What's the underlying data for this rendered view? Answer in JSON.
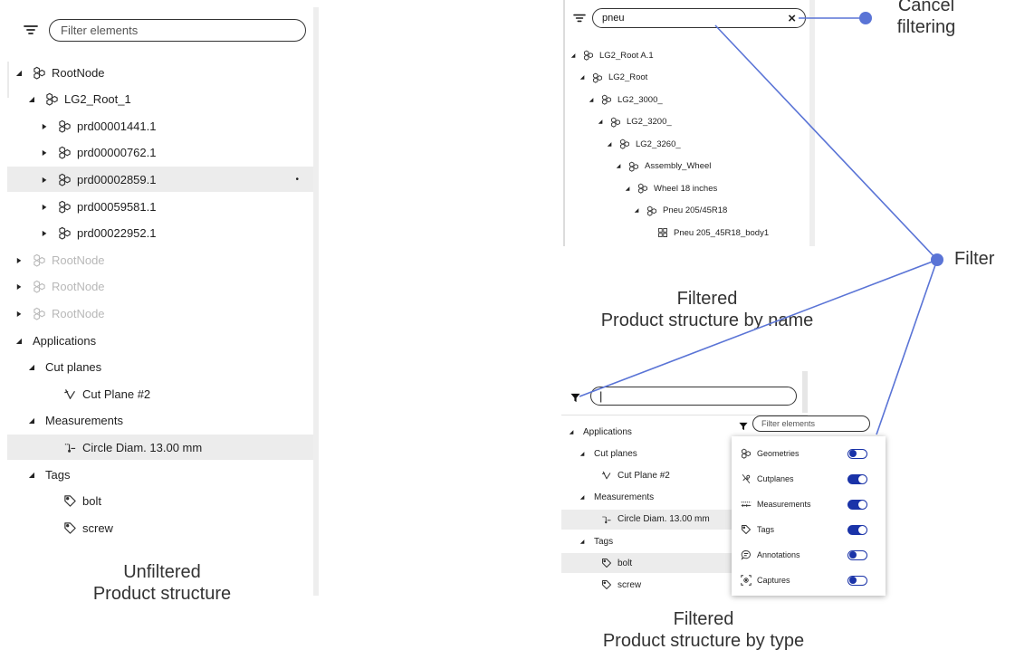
{
  "colors": {
    "accent": "#1a33a8",
    "connector": "#5a74d6",
    "selection": "#ececec"
  },
  "left_panel": {
    "filter_placeholder": "Filter elements",
    "caption": [
      "Unfiltered",
      "Product structure"
    ],
    "tree": [
      {
        "label": "RootNode",
        "icon": "assembly-icon",
        "expander": "expanded",
        "level": 0,
        "dimmed": false
      },
      {
        "label": "LG2_Root_1",
        "icon": "assembly-icon",
        "expander": "expanded",
        "level": 1,
        "dimmed": false
      },
      {
        "label": "prd00001441.1",
        "icon": "assembly-icon",
        "expander": "collapsed",
        "level": 2,
        "dimmed": false
      },
      {
        "label": "prd00000762.1",
        "icon": "assembly-icon",
        "expander": "collapsed",
        "level": 2,
        "dimmed": false
      },
      {
        "label": "prd00002859.1",
        "icon": "assembly-icon",
        "expander": "collapsed",
        "level": 2,
        "dimmed": false,
        "selected": true
      },
      {
        "label": "prd00059581.1",
        "icon": "assembly-icon",
        "expander": "collapsed",
        "level": 2,
        "dimmed": false
      },
      {
        "label": "prd00022952.1",
        "icon": "assembly-icon",
        "expander": "collapsed",
        "level": 2,
        "dimmed": false
      },
      {
        "label": "RootNode",
        "icon": "assembly-icon",
        "expander": "collapsed",
        "level": 0,
        "dimmed": true
      },
      {
        "label": "RootNode",
        "icon": "assembly-icon",
        "expander": "collapsed",
        "level": 0,
        "dimmed": true
      },
      {
        "label": "RootNode",
        "icon": "assembly-icon",
        "expander": "collapsed",
        "level": 0,
        "dimmed": true
      },
      {
        "label": "Applications",
        "icon": "",
        "expander": "expanded",
        "level": 0,
        "dimmed": false
      },
      {
        "label": "Cut planes",
        "icon": "",
        "expander": "expanded",
        "level": 1,
        "dimmed": false
      },
      {
        "label": "Cut Plane #2",
        "icon": "cut-plane-icon",
        "expander": "",
        "level": 2,
        "dimmed": false
      },
      {
        "label": "Measurements",
        "icon": "",
        "expander": "expanded",
        "level": 1,
        "dimmed": false
      },
      {
        "label": "Circle Diam. 13.00 mm",
        "icon": "measurement-icon",
        "expander": "",
        "level": 2,
        "dimmed": false,
        "selected": true
      },
      {
        "label": "Tags",
        "icon": "",
        "expander": "expanded",
        "level": 1,
        "dimmed": false
      },
      {
        "label": "bolt",
        "icon": "tag-icon",
        "expander": "",
        "level": 2,
        "dimmed": false
      },
      {
        "label": "screw",
        "icon": "tag-icon",
        "expander": "",
        "level": 2,
        "dimmed": false
      }
    ]
  },
  "name_panel": {
    "search_value": "pneu",
    "clear_glyph": "×",
    "caption": [
      "Filtered",
      "Product structure by name"
    ],
    "tree": [
      {
        "label": "LG2_Root A.1",
        "icon": "assembly-icon",
        "level": 0
      },
      {
        "label": "LG2_Root",
        "icon": "assembly-icon",
        "level": 1
      },
      {
        "label": "LG2_3000_",
        "icon": "assembly-icon",
        "level": 2
      },
      {
        "label": "LG2_3200_",
        "icon": "assembly-icon",
        "level": 3
      },
      {
        "label": "LG2_3260_",
        "icon": "assembly-icon",
        "level": 4
      },
      {
        "label": "Assembly_Wheel",
        "icon": "assembly-icon",
        "level": 5
      },
      {
        "label": "Wheel 18 inches",
        "icon": "assembly-icon",
        "level": 6
      },
      {
        "label": "Pneu 205/45R18",
        "icon": "assembly-icon",
        "level": 7
      },
      {
        "label": "Pneu 205_45R18_body1",
        "icon": "part-icon",
        "level": 8
      }
    ]
  },
  "type_panel": {
    "search_value": "|",
    "caption": [
      "Filtered",
      "Product structure by type"
    ],
    "tree": [
      {
        "label": "Applications",
        "icon": "",
        "expander": "expanded",
        "level": 0
      },
      {
        "label": "Cut planes",
        "icon": "",
        "expander": "expanded",
        "level": 1
      },
      {
        "label": "Cut Plane #2",
        "icon": "cut-plane-icon",
        "expander": "",
        "level": 2
      },
      {
        "label": "Measurements",
        "icon": "",
        "expander": "expanded",
        "level": 1
      },
      {
        "label": "Circle Diam. 13.00 mm",
        "icon": "measurement-icon",
        "expander": "",
        "level": 2,
        "selected": true
      },
      {
        "label": "Tags",
        "icon": "",
        "expander": "expanded",
        "level": 1
      },
      {
        "label": "bolt",
        "icon": "tag-icon",
        "expander": "",
        "level": 2,
        "selected": true
      },
      {
        "label": "screw",
        "icon": "tag-icon",
        "expander": "",
        "level": 2
      }
    ],
    "popup_placeholder": "Filter elements",
    "type_filters": [
      {
        "label": "Geometries",
        "icon": "geometries-icon",
        "enabled": false
      },
      {
        "label": "Cutplanes",
        "icon": "cutplanes-icon",
        "enabled": true
      },
      {
        "label": "Measurements",
        "icon": "measurements-icon",
        "enabled": true
      },
      {
        "label": "Tags",
        "icon": "tags-icon",
        "enabled": true
      },
      {
        "label": "Annotations",
        "icon": "annotations-icon",
        "enabled": false
      },
      {
        "label": "Captures",
        "icon": "captures-icon",
        "enabled": false
      }
    ]
  },
  "callouts": {
    "cancel": [
      "Cancel",
      "filtering"
    ],
    "filter": "Filter"
  }
}
